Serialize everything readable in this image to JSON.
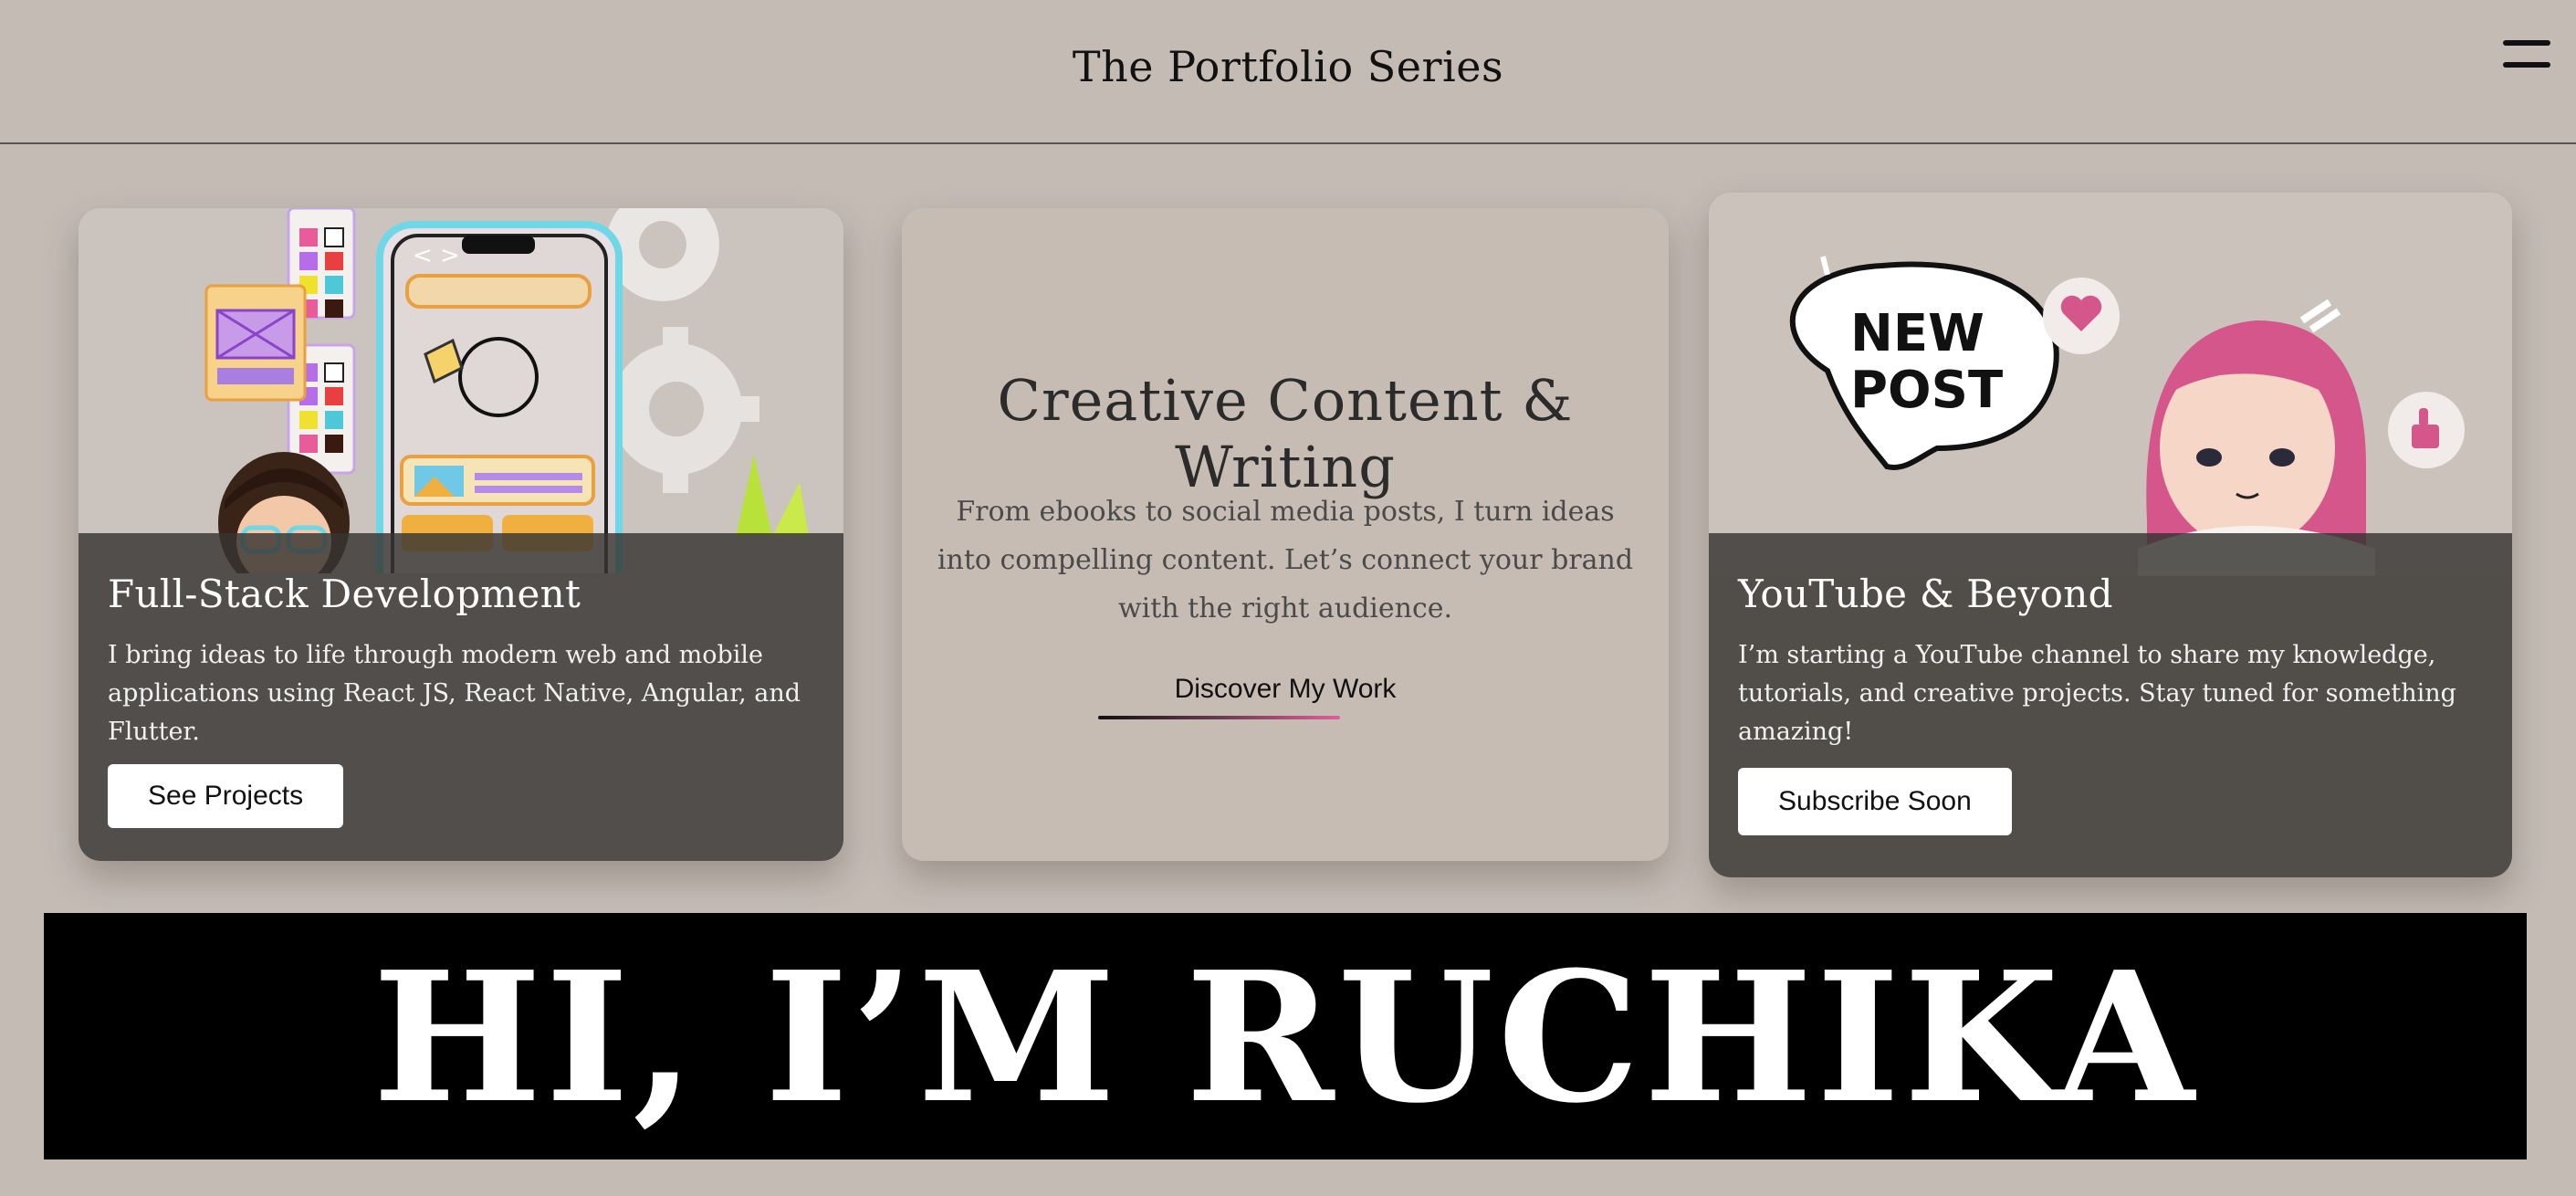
{
  "header": {
    "title": "The Portfolio Series",
    "menu_icon": "hamburger-menu-icon"
  },
  "cards": {
    "fullstack": {
      "title": "Full-Stack Development",
      "text": "I bring ideas to life through modern web and mobile applications using React JS, React Native, Angular, and Flutter.",
      "button": "See Projects",
      "illustration": "phone-app-design-illustration"
    },
    "creative": {
      "title": "Creative Content & Writing",
      "text": "From ebooks to social media posts, I turn ideas into compelling content. Let’s connect your brand with the right audience.",
      "link": "Discover My Work"
    },
    "youtube": {
      "title": "YouTube & Beyond",
      "text": "I’m starting a YouTube channel to share my knowledge, tutorials, and creative projects. Stay tuned for something amazing!",
      "button": "Subscribe Soon",
      "bubble_line1": "NEW",
      "bubble_line2": "POST",
      "illustration": "new-post-girl-illustration"
    }
  },
  "banner": {
    "text": "HI, I’M RUCHIKA"
  },
  "colors": {
    "background": "#c4bbb5",
    "overlay": "#373432",
    "accent_pink": "#e0609a",
    "banner": "#000000"
  }
}
